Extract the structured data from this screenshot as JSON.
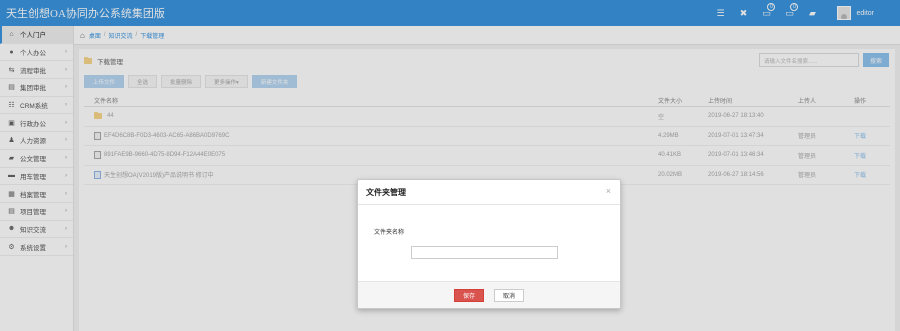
{
  "app": {
    "title": "天生创想OA协同办公系统集团版"
  },
  "topbar": {
    "icons": [
      {
        "name": "menu-icon",
        "glyph": "☰",
        "badge": ""
      },
      {
        "name": "expand-icon",
        "glyph": "✖",
        "badge": ""
      },
      {
        "name": "messages-icon",
        "glyph": "💬",
        "badge": "0"
      },
      {
        "name": "notifications-icon",
        "glyph": "💬",
        "badge": "0"
      },
      {
        "name": "chat-icon",
        "glyph": "▪",
        "badge": ""
      }
    ],
    "user": "editor"
  },
  "sidebar": {
    "items": [
      {
        "label": "个人门户",
        "icon": "⌂",
        "name": "home-icon",
        "active": true
      },
      {
        "label": "个人办公",
        "icon": "●",
        "name": "user-icon"
      },
      {
        "label": "流程审批",
        "icon": "⇆",
        "name": "exchange-icon"
      },
      {
        "label": "集团审批",
        "icon": "▤",
        "name": "group-approval-icon"
      },
      {
        "label": "CRM系统",
        "icon": "☷",
        "name": "crm-icon"
      },
      {
        "label": "行政办公",
        "icon": "▣",
        "name": "admin-office-icon"
      },
      {
        "label": "人力资源",
        "icon": "♟",
        "name": "hr-icon"
      },
      {
        "label": "公文管理",
        "icon": "▰",
        "name": "document-icon"
      },
      {
        "label": "用车管理",
        "icon": "▬",
        "name": "car-icon"
      },
      {
        "label": "档案管理",
        "icon": "▦",
        "name": "archive-icon"
      },
      {
        "label": "项目管理",
        "icon": "▤",
        "name": "project-icon"
      },
      {
        "label": "知识交流",
        "icon": "☻",
        "name": "knowledge-icon"
      },
      {
        "label": "系统设置",
        "icon": "⚙",
        "name": "gear-icon"
      }
    ]
  },
  "breadcrumb": {
    "home": "桌面",
    "section": "知识交流",
    "page": "下载管理"
  },
  "panel": {
    "path": "下载管理",
    "search_placeholder": "请输入文件名搜索......",
    "search_button": "搜索",
    "toolbar": [
      {
        "label": "上传文件",
        "style": "blue",
        "name": "upload-file-button"
      },
      {
        "label": "全选",
        "style": "gray",
        "name": "select-all-button"
      },
      {
        "label": "批量删除",
        "style": "gray",
        "name": "batch-delete-button"
      },
      {
        "label": "更多操作▾",
        "style": "gray",
        "name": "more-actions-button"
      },
      {
        "label": "新建文件夹",
        "style": "blue",
        "name": "new-folder-button"
      }
    ]
  },
  "table": {
    "headers": {
      "name": "文件名称",
      "size": "文件大小",
      "time": "上传时间",
      "owner": "上传人",
      "op": "操作"
    },
    "rows": [
      {
        "type": "folder",
        "name": "44",
        "size": "空",
        "time": "2019-06-27 18:13:40",
        "owner": "",
        "op": ""
      },
      {
        "type": "file",
        "name": "EF4D6C8B-F0D3-4603-AC65-A86BA0D9769C",
        "size": "4.29MB",
        "time": "2019-07-01 13:47:34",
        "owner": "管理员",
        "op": "下载"
      },
      {
        "type": "file",
        "name": "891FAE9B-9660-4D75-8D94-F12A44E0E075",
        "size": "40.41KB",
        "time": "2019-07-01 13:46:34",
        "owner": "管理员",
        "op": "下载"
      },
      {
        "type": "doc",
        "name": "天生创想OA(V2019版)产品说明书 修订中",
        "size": "20.02MB",
        "time": "2019-06-27 18:14:56",
        "owner": "管理员",
        "op": "下载"
      }
    ]
  },
  "modal": {
    "title": "文件夹管理",
    "field_label": "文件夹名称",
    "field_value": "",
    "save": "保存",
    "cancel": "取消"
  }
}
